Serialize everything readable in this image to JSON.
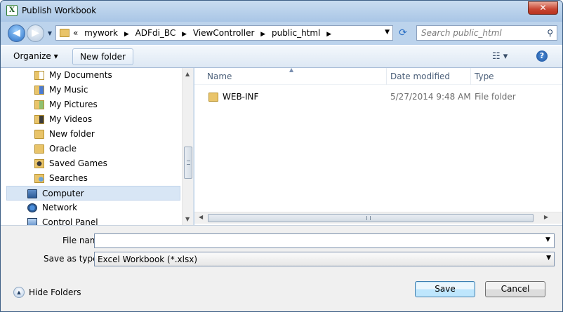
{
  "window": {
    "title": "Publish Workbook",
    "app_icon_glyph": "X",
    "close_glyph": "✕"
  },
  "navigation": {
    "back_glyph": "◀",
    "forward_glyph": "▶",
    "recent_glyph": "▼",
    "breadcrumb": [
      "«",
      "mywork",
      "ADFdi_BC",
      "ViewController",
      "public_html"
    ],
    "breadcrumb_separator": "▶",
    "address_dropdown_glyph": "▼",
    "refresh_glyph": "⟳",
    "search_placeholder": "Search public_html",
    "search_glyph": "⚲"
  },
  "toolbar": {
    "organize_label": "Organize ▾",
    "new_folder_label": "New folder",
    "view_glyph": "☷ ▾",
    "help_glyph": "?"
  },
  "sidebar": {
    "items": [
      {
        "label": "My Documents",
        "icon": "documents-folder-icon"
      },
      {
        "label": "My Music",
        "icon": "music-folder-icon"
      },
      {
        "label": "My Pictures",
        "icon": "pictures-folder-icon"
      },
      {
        "label": "My Videos",
        "icon": "videos-folder-icon"
      },
      {
        "label": "New folder",
        "icon": "folder-icon"
      },
      {
        "label": "Oracle",
        "icon": "folder-icon"
      },
      {
        "label": "Saved Games",
        "icon": "saved-games-icon"
      },
      {
        "label": "Searches",
        "icon": "searches-folder-icon"
      },
      {
        "label": "Computer",
        "icon": "computer-icon"
      },
      {
        "label": "Network",
        "icon": "network-icon"
      },
      {
        "label": "Control Panel",
        "icon": "control-panel-icon"
      }
    ],
    "scroll_up_glyph": "▲",
    "scroll_down_glyph": "▼"
  },
  "file_list": {
    "columns": [
      "Name",
      "Date modified",
      "Type"
    ],
    "sort_glyph": "▲",
    "rows": [
      {
        "name": "WEB-INF",
        "date_modified": "5/27/2014 9:48 AM",
        "type": "File folder"
      }
    ],
    "scroll_left_glyph": "◀",
    "scroll_right_glyph": "▶"
  },
  "form": {
    "file_name_label": "File name:",
    "file_name_value": "",
    "file_name_dropdown_glyph": "▼",
    "save_as_type_label": "Save as type:",
    "save_as_type_value": "Excel Workbook (*.xlsx)",
    "save_as_type_dropdown_glyph": "▼"
  },
  "footer": {
    "hide_folders_label": "Hide Folders",
    "hide_folders_glyph": "▲",
    "save_label": "Save",
    "cancel_label": "Cancel"
  }
}
